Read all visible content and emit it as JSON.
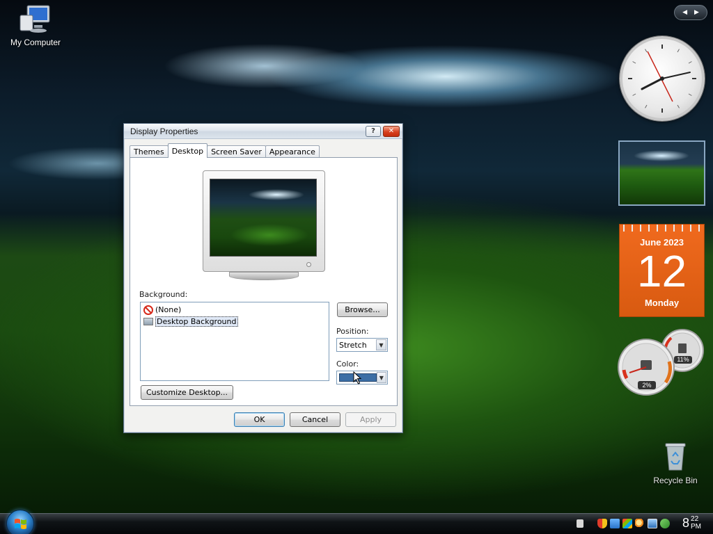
{
  "desktop": {
    "icons": [
      {
        "label": "My Computer"
      },
      {
        "label": "Recycle Bin"
      }
    ]
  },
  "sidebar": {
    "calendar": {
      "month_year": "June 2023",
      "day": "12",
      "weekday": "Monday"
    },
    "meters": {
      "cpu_percent": "2%",
      "memory_percent": "11%"
    }
  },
  "dialog": {
    "title": "Display Properties",
    "help_glyph": "?",
    "close_glyph": "✕",
    "tabs": [
      {
        "label": "Themes"
      },
      {
        "label": "Desktop"
      },
      {
        "label": "Screen Saver"
      },
      {
        "label": "Appearance"
      }
    ],
    "active_tab": "Desktop",
    "background_label": "Background:",
    "background_items": [
      {
        "label": "(None)",
        "icon": "no-entry-icon"
      },
      {
        "label": "Desktop Background",
        "icon": "image-icon",
        "selected": true
      }
    ],
    "browse_label": "Browse...",
    "position_label": "Position:",
    "position_value": "Stretch",
    "color_label": "Color:",
    "color_value": "#3c6ea5",
    "customize_label": "Customize Desktop...",
    "ok_label": "OK",
    "cancel_label": "Cancel",
    "apply_label": "Apply"
  },
  "taskbar": {
    "clock_hour": "8",
    "clock_minutes": "22",
    "clock_ampm": "PM"
  }
}
